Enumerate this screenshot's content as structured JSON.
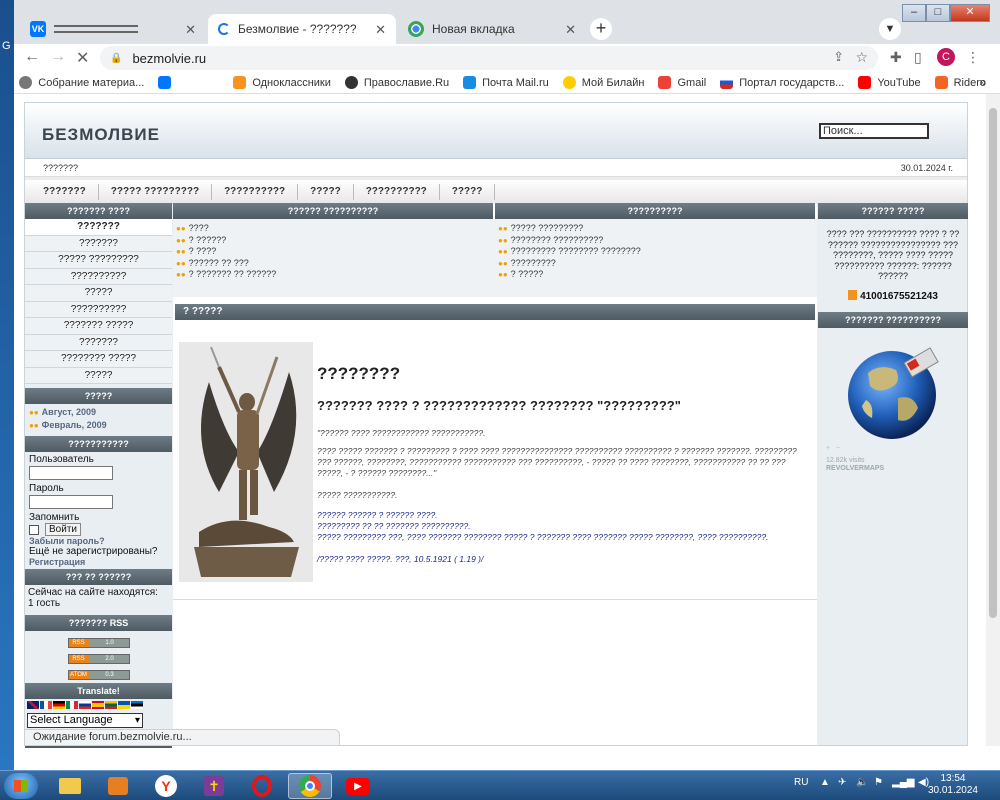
{
  "desktop": {
    "left_letter": "G"
  },
  "browser": {
    "tabs": [
      {
        "title": "",
        "favicon": "vk-icon",
        "active": false
      },
      {
        "title": "Безмолвие - ???????",
        "favicon": "loading-icon",
        "active": true
      },
      {
        "title": "Новая вкладка",
        "favicon": "chrome-icon",
        "active": false
      }
    ],
    "url": "bezmolvie.ru",
    "profile_initial": "C",
    "bookmarks": [
      {
        "label": "Собрание материа...",
        "color": "#777777"
      },
      {
        "label": "",
        "color": "#0077ff"
      },
      {
        "label": "Одноклассники",
        "color": "#f7931e"
      },
      {
        "label": "Православие.Ru",
        "color": "#333333"
      },
      {
        "label": "Почта Mail.ru",
        "color": "#168de2"
      },
      {
        "label": "Мой Билайн",
        "color": "#ffcc00"
      },
      {
        "label": "Gmail",
        "color": "#ea4335"
      },
      {
        "label": "Портал государств...",
        "color": "#d52b1e"
      },
      {
        "label": "YouTube",
        "color": "#ff0000"
      },
      {
        "label": "Ridero",
        "color": "#f26522"
      }
    ],
    "more": "»",
    "status": "Ожидание forum.bezmolvie.ru..."
  },
  "site": {
    "title": "БЕЗМОЛВИЕ",
    "search_placeholder": "Поиск...",
    "info_left": "???????",
    "date": "30.01.2024 г.",
    "top_menu": [
      "???????",
      "????? ?????????",
      "??????????",
      "?????",
      "??????????",
      "?????"
    ],
    "left": {
      "menu_head": "??????? ????",
      "menu": [
        "???????",
        "???????",
        "????? ?????????",
        "??????????",
        "?????",
        "??????????",
        "??????? ?????",
        "???????",
        "???????? ?????",
        "?????"
      ],
      "archive_head": "?????",
      "archive": [
        "Август, 2009",
        "Февраль, 2009"
      ],
      "login_head": "???????????",
      "user_label": "Пользователь",
      "pass_label": "Пароль",
      "remember_label": "Запомнить",
      "login_button": "Войти",
      "forgot": "Забыли пароль?",
      "not_registered": "Ещё не зарегистрированы?",
      "register": "Регистрация",
      "online_head": "??? ?? ??????",
      "online_text": "Сейчас на сайте находятся:",
      "online_count": "1 гость",
      "rss_head": "??????? RSS",
      "rss": [
        {
          "tag": "RSS",
          "ver": "1.0"
        },
        {
          "tag": "RSS",
          "ver": "2.0"
        },
        {
          "tag": "ATOM",
          "ver": "0.3"
        }
      ],
      "translate_head": "Translate!",
      "lang_select": "Select Language",
      "last_head": "????????"
    },
    "center": {
      "col1_head": "?????? ??????????",
      "col1_items": [
        "????",
        "? ??????",
        "? ????",
        "?????? ?? ???",
        "? ??????? ?? ??????"
      ],
      "col2_head": "??????????",
      "col2_items": [
        "????? ?????????",
        "???????? ??????????",
        "????????? ???????? ????????",
        "?????????",
        "? ?????"
      ],
      "news_head": "? ?????",
      "article_title": "????????",
      "article_subtitle": "??????? ???? ? ????????????? ???????? \"?????????\"",
      "quote": "\"?????? ???? ???????????? ???????????.",
      "para": "???? ????? ??????? ? ????????? ? ???? ???? ??????????????? ?????????? ?????????? ? ??????? ???????. ????????? ??? ??????, ????????, ??????????? ??????????? ??? ??????????, - ????? ?? ???? ????????, ??????????? ?? ?? ??? ?????, - ? ?????? ????????...\"",
      "tail": "????? ???????????.",
      "blue1": "?????? ?????? ? ?????? ????.",
      "blue2": "????????? ?? ?? ??????? ??????????.",
      "blue3": "????? ????????? ???, ???? ??????? ???????? ????? ? ??????? ???? ??????? ????? ????????, ???? ??????????.",
      "blue4": "/????? ???? ?????. ???, 10.5.1921 ( 1.19 )/"
    },
    "right": {
      "head1": "?????? ?????",
      "text1": "???? ??? ?????????? ???? ? ?? ?????? ???????????????? ??? ????????, ????? ???? ????? ?????????? ??????: ?????? ??????",
      "wallet": "41001675521243",
      "head2": "??????? ??????????",
      "stats_visits": "12.82k visits",
      "stats_brand": "REVOLVERMAPS"
    }
  },
  "taskbar": {
    "lang": "RU",
    "time": "13:54",
    "date": "30.01.2024"
  }
}
